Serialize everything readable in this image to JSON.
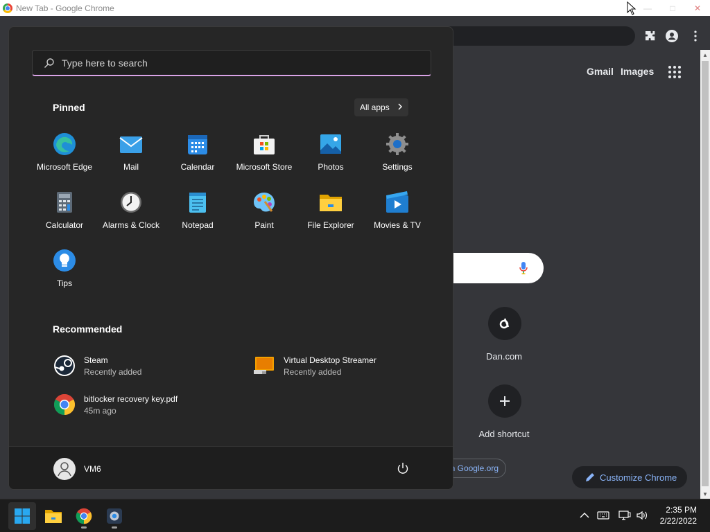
{
  "window": {
    "title": "New Tab - Google Chrome"
  },
  "ntp": {
    "gmail": "Gmail",
    "images": "Images",
    "shortcuts": [
      {
        "label": "Dan.com"
      },
      {
        "label": "Add shortcut"
      }
    ],
    "googleorg": "n Google.org",
    "customize": "Customize Chrome"
  },
  "start_menu": {
    "search_placeholder": "Type here to search",
    "pinned_title": "Pinned",
    "all_apps": "All apps",
    "pinned": [
      {
        "label": "Microsoft Edge",
        "icon": "edge-icon"
      },
      {
        "label": "Mail",
        "icon": "mail-icon"
      },
      {
        "label": "Calendar",
        "icon": "calendar-icon"
      },
      {
        "label": "Microsoft Store",
        "icon": "store-icon"
      },
      {
        "label": "Photos",
        "icon": "photos-icon"
      },
      {
        "label": "Settings",
        "icon": "settings-gear-icon"
      },
      {
        "label": "Calculator",
        "icon": "calculator-icon"
      },
      {
        "label": "Alarms & Clock",
        "icon": "clock-icon"
      },
      {
        "label": "Notepad",
        "icon": "notepad-icon"
      },
      {
        "label": "Paint",
        "icon": "paint-palette-icon"
      },
      {
        "label": "File Explorer",
        "icon": "folder-icon"
      },
      {
        "label": "Movies & TV",
        "icon": "movies-icon"
      },
      {
        "label": "Tips",
        "icon": "lightbulb-icon"
      }
    ],
    "recommended_title": "Recommended",
    "recommended": [
      {
        "name": "Steam",
        "sub": "Recently added",
        "icon": "steam-icon"
      },
      {
        "name": "Virtual Desktop Streamer",
        "sub": "Recently added",
        "icon": "monitor-icon"
      },
      {
        "name": "bitlocker recovery key.pdf",
        "sub": "45m ago",
        "icon": "chrome-icon"
      }
    ],
    "user": "VM6"
  },
  "taskbar": {
    "time": "2:35 PM",
    "date": "2/22/2022"
  },
  "colors": {
    "accent_purple": "#d9a3e6",
    "link_blue": "#8ab4f8",
    "windows_blue": "#29a8f0"
  }
}
